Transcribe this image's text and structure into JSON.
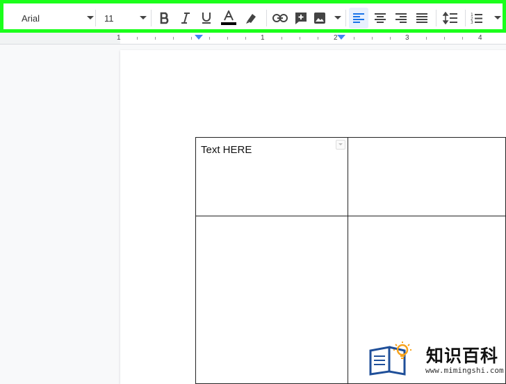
{
  "toolbar": {
    "font_family": "Arial",
    "font_size": "11",
    "icons": [
      "bold-icon",
      "italic-icon",
      "underline-icon",
      "text-color-icon",
      "highlight-icon",
      "link-icon",
      "comment-icon",
      "image-icon",
      "align-left-icon",
      "align-center-icon",
      "align-right-icon",
      "justify-icon",
      "line-spacing-icon",
      "numbered-list-icon"
    ],
    "active_alignment": "left",
    "highlight_color": "#1bff1b",
    "active_color": "#1a73e8"
  },
  "ruler": {
    "labels": [
      "1",
      "1",
      "2",
      "3",
      "4"
    ]
  },
  "document": {
    "table": {
      "cells": [
        [
          "Text HERE",
          ""
        ],
        [
          "",
          ""
        ]
      ]
    }
  },
  "watermark": {
    "title": "知识百科",
    "url": "www.mimingshi.com"
  }
}
